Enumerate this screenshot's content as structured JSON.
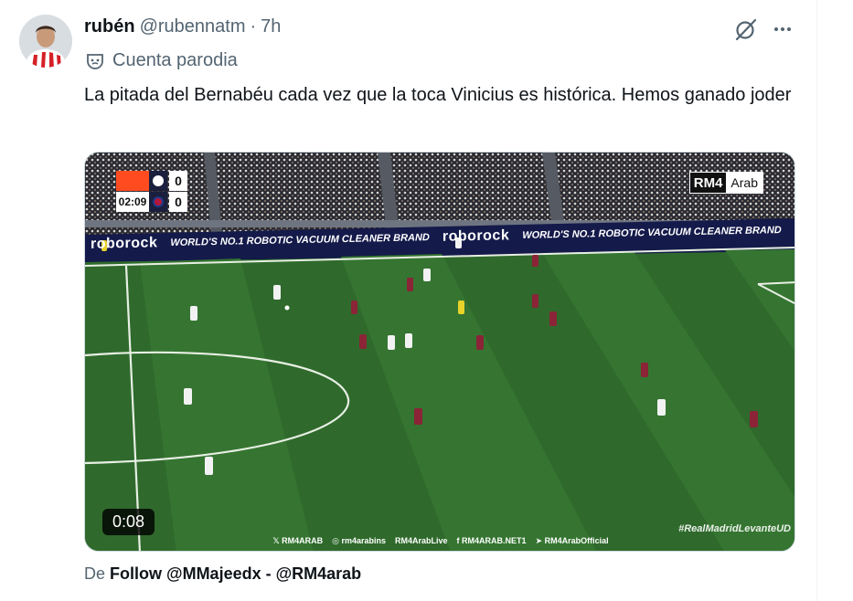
{
  "tweet": {
    "display_name": "rubén",
    "handle": "@rubennatm",
    "separator": "·",
    "time": "7h",
    "parody_label": "Cuenta parodia",
    "text": "La pitada del Bernabéu cada vez que la toca Vinicius es histórica. Hemos ganado joder",
    "icons": {
      "grok": "grok-slash-icon",
      "more": "more-dots-icon",
      "parody": "mask-icon"
    }
  },
  "video": {
    "clock": "02:09",
    "home_score": "0",
    "away_score": "0",
    "brand_main": "RM4",
    "brand_sub": "Arab",
    "ad_logo": "roborock",
    "ad_slogan": "WORLD'S NO.1 ROBOTIC VACUUM CLEANER BRAND",
    "duration": "0:08",
    "hashtag": "#RealMadridLevanteUD",
    "socials": [
      "𝕏 RM4ARAB",
      "◎ rm4arabins",
      "RM4ArabLive",
      "f RM4ARAB.NET1",
      "➤ RM4ArabOfficial"
    ]
  },
  "source": {
    "prefix": "De",
    "text": "Follow @MMajeedx - @RM4arab"
  },
  "colors": {
    "grass": "#2f6a2c",
    "text": "#0f1419",
    "secondary": "#536471"
  }
}
